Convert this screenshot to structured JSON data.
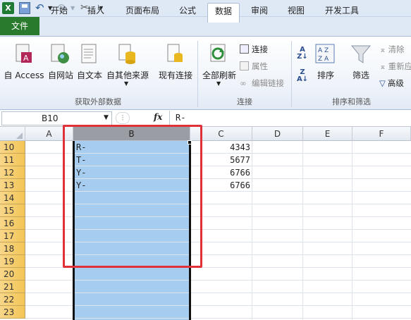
{
  "qat": {
    "icons": [
      "excel-icon",
      "save-icon",
      "undo-icon",
      "redo-icon",
      "customize-icon"
    ]
  },
  "tabs": [
    {
      "label": "文件"
    },
    {
      "label": "开始"
    },
    {
      "label": "插入"
    },
    {
      "label": "页面布局"
    },
    {
      "label": "公式"
    },
    {
      "label": "数据"
    },
    {
      "label": "审阅"
    },
    {
      "label": "视图"
    },
    {
      "label": "开发工具"
    }
  ],
  "active_tab": "数据",
  "ribbon": {
    "external": {
      "access": "自 Access",
      "web": "自网站",
      "text": "自文本",
      "other": "自其他来源",
      "existing": "现有连接",
      "group": "获取外部数据"
    },
    "connections": {
      "refresh": "全部刷新",
      "conn": "连接",
      "props": "属性",
      "edit": "编辑链接",
      "group": "连接"
    },
    "sort": {
      "sort": "排序",
      "filter": "筛选",
      "clear": "清除",
      "reapply": "重新应",
      "advanced": "高级",
      "group": "排序和筛选"
    }
  },
  "formula_bar": {
    "name_box": "B10",
    "fx": "fx",
    "formula": "R-"
  },
  "columns": [
    "A",
    "B",
    "C",
    "D",
    "E",
    "F"
  ],
  "rows": [
    "10",
    "11",
    "12",
    "13",
    "14",
    "15",
    "16",
    "17",
    "18",
    "19",
    "20",
    "21",
    "22",
    "23"
  ],
  "cells": {
    "B": [
      "R-",
      "T-",
      "Y-",
      "Y-"
    ],
    "C": [
      "4343",
      "5677",
      "6766",
      "6766"
    ]
  },
  "colors": {
    "selection": "#a6cdef",
    "highlight_box": "#e0303a",
    "file_tab": "#2a7a2e",
    "row_header": "#f3c556"
  }
}
